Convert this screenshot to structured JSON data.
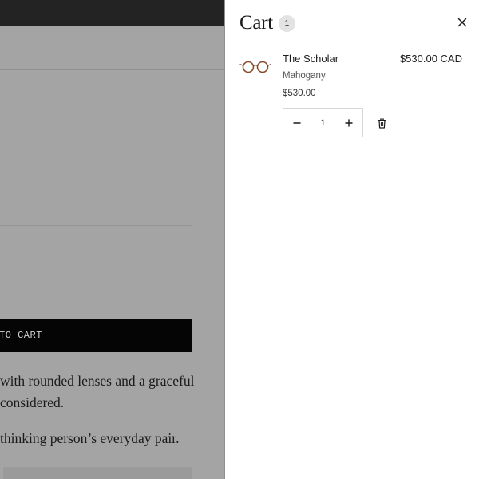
{
  "background_page": {
    "add_to_cart_label": "TO CART",
    "description_lines": [
      "with rounded lenses and a graceful",
      "considered.",
      "thinking person’s everyday pair."
    ]
  },
  "cart": {
    "title": "Cart",
    "count": "1",
    "items": [
      {
        "name": "The Scholar",
        "variant": "Mahogany",
        "unit_price": "$530.00",
        "line_total": "$530.00 CAD",
        "quantity": "1",
        "thumbnail_icon": "eyeglasses-icon"
      }
    ],
    "close_icon": "close-icon",
    "remove_icon": "trash-icon",
    "decrease_icon": "minus-icon",
    "increase_icon": "plus-icon"
  },
  "colors": {
    "overlay_gray": "#a4a4a4",
    "top_bar": "#232323",
    "drawer_bg": "#ffffff",
    "badge_bg": "#e3e3e3",
    "add_to_cart_bg": "#050505",
    "frame_mahogany": "#8a4a2c"
  }
}
